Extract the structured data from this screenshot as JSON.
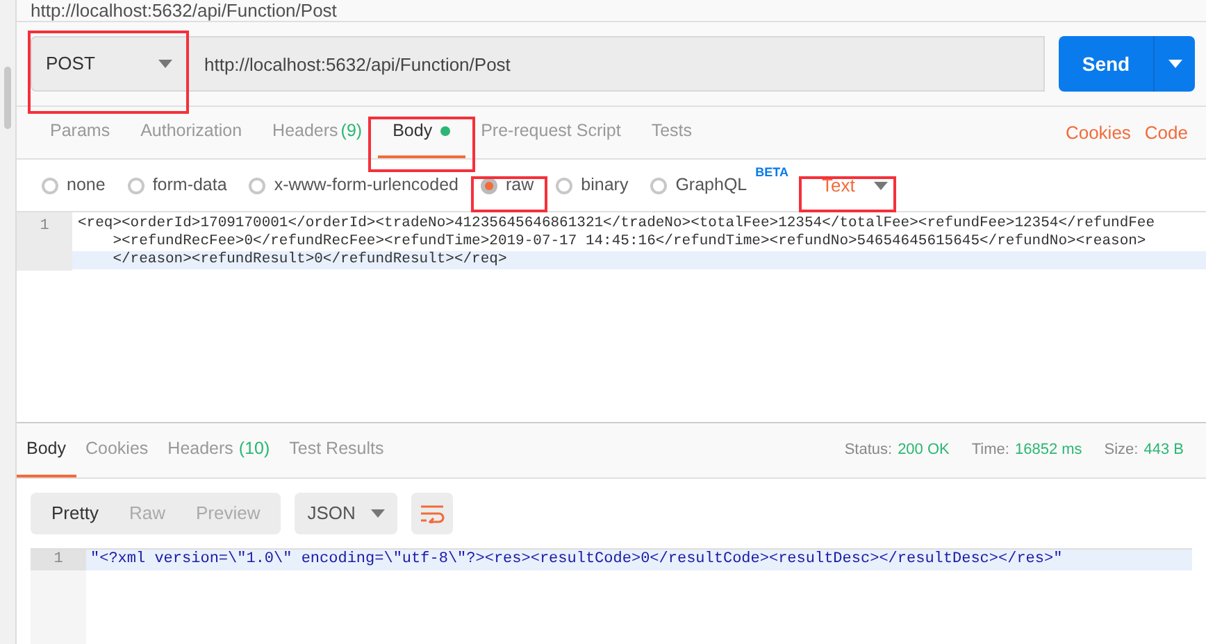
{
  "window": {
    "title": "http://localhost:5632/api/Function/Post"
  },
  "request": {
    "method": "POST",
    "url": "http://localhost:5632/api/Function/Post",
    "send_label": "Send"
  },
  "request_tabs": [
    {
      "label": "Params",
      "selected": false
    },
    {
      "label": "Authorization",
      "selected": false
    },
    {
      "label": "Headers",
      "count": "(9)",
      "selected": false
    },
    {
      "label": "Body",
      "selected": true,
      "dot": true
    },
    {
      "label": "Pre-request Script",
      "selected": false
    },
    {
      "label": "Tests",
      "selected": false
    }
  ],
  "links": [
    "Cookies",
    "Code"
  ],
  "body_types": [
    {
      "label": "none",
      "selected": false
    },
    {
      "label": "form-data",
      "selected": false
    },
    {
      "label": "x-www-form-urlencoded",
      "selected": false
    },
    {
      "label": "raw",
      "selected": true
    },
    {
      "label": "binary",
      "selected": false
    },
    {
      "label": "GraphQL",
      "badge": "BETA",
      "selected": false
    }
  ],
  "format": "Text",
  "request_body": {
    "line_number": "1",
    "lines": [
      "<req><orderId>1709170001</orderId><tradeNo>41235645646861321</tradeNo><totalFee>12354</totalFee><refundFee>12354</refundFee",
      "    ><refundRecFee>0</refundRecFee><refundTime>2019-07-17 14:45:16</refundTime><refundNo>54654645615645</refundNo><reason>",
      "    </reason><refundResult>0</refundResult></req>"
    ]
  },
  "response_tabs": [
    {
      "label": "Body",
      "selected": true
    },
    {
      "label": "Cookies",
      "selected": false
    },
    {
      "label": "Headers",
      "count": "(10)",
      "selected": false
    },
    {
      "label": "Test Results",
      "selected": false
    }
  ],
  "stats": [
    {
      "label": "Status:",
      "value": "200 OK"
    },
    {
      "label": "Time:",
      "value": "16852 ms"
    },
    {
      "label": "Size:",
      "value": "443 B"
    }
  ],
  "view_modes": [
    {
      "label": "Pretty",
      "selected": true
    },
    {
      "label": "Raw",
      "selected": false
    },
    {
      "label": "Preview",
      "selected": false
    }
  ],
  "response_format": "JSON",
  "response_body": {
    "line_number": "1",
    "text": "\"<?xml version=\\\"1.0\\\" encoding=\\\"utf-8\\\"?><res><resultCode>0</resultCode><resultDesc></resultDesc></res>\""
  }
}
